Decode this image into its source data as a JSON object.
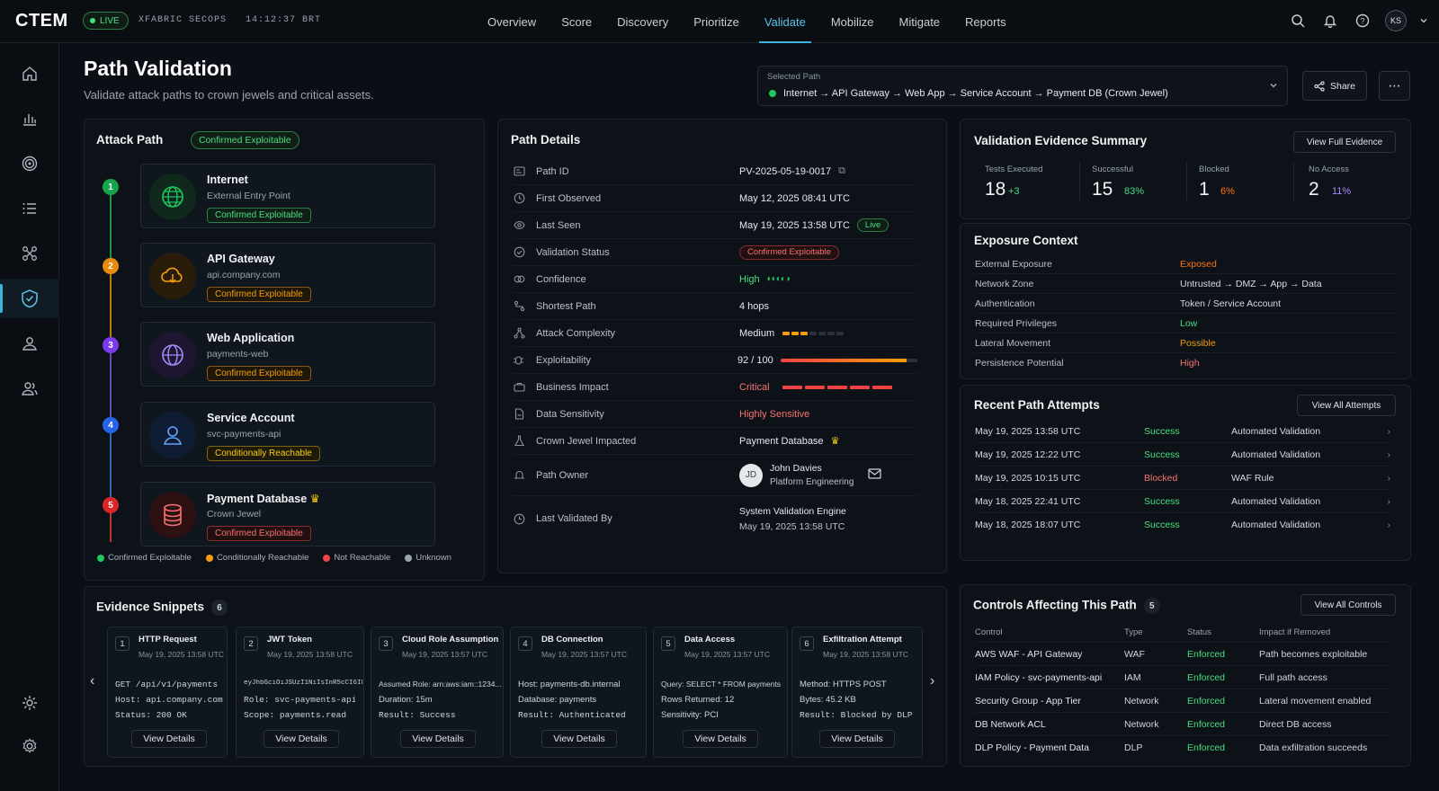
{
  "app": {
    "logo": "CTEM",
    "live": "LIVE",
    "org": "XFABRIC SECOPS",
    "clock": "14:12:37 BRT",
    "avatar": "KS"
  },
  "nav": [
    "Overview",
    "Score",
    "Discovery",
    "Prioritize",
    "Validate",
    "Mobilize",
    "Mitigate",
    "Reports"
  ],
  "page": {
    "title": "Path Validation",
    "subtitle": "Validate attack paths to crown jewels and critical assets.",
    "selected_label": "Selected Path",
    "selected_value": "Internet → API Gateway → Web App → Service Account → Payment DB (Crown Jewel)",
    "share": "Share"
  },
  "attack_path": {
    "title": "Attack Path",
    "status": "Confirmed Exploitable",
    "hops": [
      {
        "num": "1",
        "name": "Internet",
        "sub": "External Entry Point",
        "badge": "Confirmed Exploitable",
        "color": "#22c55e",
        "icon": "globe-icon"
      },
      {
        "num": "2",
        "name": "API Gateway",
        "sub": "api.company.com",
        "badge": "Confirmed Exploitable",
        "color": "#f59e0b",
        "icon": "cloud-icon"
      },
      {
        "num": "3",
        "name": "Web Application",
        "sub": "payments-web",
        "badge": "Confirmed Exploitable",
        "color": "#8b5cf6",
        "icon": "web-icon"
      },
      {
        "num": "4",
        "name": "Service Account",
        "sub": "svc-payments-api",
        "badge": "Conditionally Reachable",
        "color": "#3b82f6",
        "icon": "user-icon"
      },
      {
        "num": "5",
        "name": "Payment Database",
        "sub": "Crown Jewel",
        "badge": "Confirmed Exploitable",
        "color": "#ef4444",
        "icon": "database-icon"
      }
    ],
    "legend": [
      "Confirmed Exploitable",
      "Conditionally Reachable",
      "Not Reachable",
      "Unknown"
    ]
  },
  "details": {
    "title": "Path Details",
    "path_id_k": "Path ID",
    "path_id": "PV-2025-05-19-0017",
    "first_k": "First Observed",
    "first": "May 12, 2025 08:41 UTC",
    "last_k": "Last Seen",
    "last": "May 19, 2025 13:58 UTC",
    "live": "Live",
    "vstatus_k": "Validation Status",
    "vstatus": "Confirmed Exploitable",
    "conf_k": "Confidence",
    "conf": "High",
    "short_k": "Shortest Path",
    "short": "4 hops",
    "complex_k": "Attack Complexity",
    "complex": "Medium",
    "exploit_k": "Exploitability",
    "exploit": "92 / 100",
    "exploit_score": 0.92,
    "impact_k": "Business Impact",
    "impact": "Critical",
    "sens_k": "Data Sensitivity",
    "sens": "Highly Sensitive",
    "crown_k": "Crown Jewel Impacted",
    "crown": "Payment Database",
    "owner_k": "Path Owner",
    "owner_name": "John Davies",
    "owner_team": "Platform Engineering",
    "owner_init": "JD",
    "lvb_k": "Last Validated By",
    "lvb": "System Validation Engine",
    "lvb_date": "May 19, 2025 13:58 UTC"
  },
  "evidence_summary": {
    "title": "Validation Evidence Summary",
    "btn": "View Full Evidence",
    "stats": [
      {
        "label": "Tests Executed",
        "value": "18",
        "delta": "+3",
        "color": "#4ade80"
      },
      {
        "label": "Successful",
        "value": "15",
        "delta": "83%",
        "color": "#4ade80"
      },
      {
        "label": "Blocked",
        "value": "1",
        "delta": "6%",
        "color": "#f97316"
      },
      {
        "label": "No Access",
        "value": "2",
        "delta": "11%",
        "color": "#a78bfa"
      }
    ]
  },
  "exposure": {
    "title": "Exposure Context",
    "rows": [
      {
        "k": "External Exposure",
        "v": "Exposed",
        "c": "#f97316"
      },
      {
        "k": "Network Zone",
        "v": "Untrusted → DMZ → App → Data",
        "c": "#d6dbe1"
      },
      {
        "k": "Authentication",
        "v": "Token / Service Account",
        "c": "#d6dbe1"
      },
      {
        "k": "Required Privileges",
        "v": "Low",
        "c": "#4ade80"
      },
      {
        "k": "Lateral Movement",
        "v": "Possible",
        "c": "#f59e0b"
      },
      {
        "k": "Persistence Potential",
        "v": "High",
        "c": "#f87171"
      }
    ]
  },
  "attempts": {
    "title": "Recent Path Attempts",
    "btn": "View All Attempts",
    "rows": [
      {
        "date": "May 19, 2025 13:58 UTC",
        "status": "Success",
        "type": "Automated Validation",
        "c": "#4ade80"
      },
      {
        "date": "May 19, 2025 12:22 UTC",
        "status": "Success",
        "type": "Automated Validation",
        "c": "#4ade80"
      },
      {
        "date": "May 19, 2025 10:15 UTC",
        "status": "Blocked",
        "type": "WAF Rule",
        "c": "#f87171"
      },
      {
        "date": "May 18, 2025 22:41 UTC",
        "status": "Success",
        "type": "Automated Validation",
        "c": "#4ade80"
      },
      {
        "date": "May 18, 2025 18:07 UTC",
        "status": "Success",
        "type": "Automated Validation",
        "c": "#4ade80"
      }
    ]
  },
  "controls": {
    "title": "Controls Affecting This Path",
    "count": "5",
    "btn": "View All Controls",
    "headers": [
      "Control",
      "Type",
      "Status",
      "Impact if Removed"
    ],
    "rows": [
      {
        "control": "AWS WAF - API Gateway",
        "type": "WAF",
        "status": "Enforced",
        "impact": "Path becomes exploitable"
      },
      {
        "control": "IAM Policy - svc-payments-api",
        "type": "IAM",
        "status": "Enforced",
        "impact": "Full path access"
      },
      {
        "control": "Security Group - App Tier",
        "type": "Network",
        "status": "Enforced",
        "impact": "Lateral movement enabled"
      },
      {
        "control": "DB Network ACL",
        "type": "Network",
        "status": "Enforced",
        "impact": "Direct DB access"
      },
      {
        "control": "DLP Policy - Payment Data",
        "type": "DLP",
        "status": "Enforced",
        "impact": "Data exfiltration succeeds"
      }
    ]
  },
  "snippets": {
    "title": "Evidence Snippets",
    "count": "6",
    "btn": "View Details",
    "items": [
      {
        "num": "1",
        "title": "HTTP Request",
        "date": "May 19, 2025 13:58 UTC",
        "l1": "GET /api/v1/payments",
        "l2": "Host: api.company.com",
        "l3": "Status: 200 OK"
      },
      {
        "num": "2",
        "title": "JWT Token",
        "date": "May 19, 2025 13:58 UTC",
        "l1": "eyJhbGciOiJSUzI1NiIsInR5cCI6Ik...",
        "l2": "Role: svc-payments-api",
        "l3": "Scope: payments.read"
      },
      {
        "num": "3",
        "title": "Cloud Role Assumption",
        "date": "May 19, 2025 13:57 UTC",
        "l1": "Assumed Role: arn:aws:iam::1234...",
        "l2": "Duration: 15m",
        "l3": "Result: Success"
      },
      {
        "num": "4",
        "title": "DB Connection",
        "date": "May 19, 2025 13:57 UTC",
        "l1": "Host: payments-db.internal",
        "l2": "Database: payments",
        "l3": "Result: Authenticated"
      },
      {
        "num": "5",
        "title": "Data Access",
        "date": "May 19, 2025 13:57 UTC",
        "l1": "Query: SELECT * FROM payments",
        "l2": "Rows Returned: 12",
        "l3": "Sensitivity: PCI"
      },
      {
        "num": "6",
        "title": "Exfiltration Attempt",
        "date": "May 19, 2025 13:58 UTC",
        "l1": "Method: HTTPS POST",
        "l2": "Bytes: 45.2 KB",
        "l3": "Result: Blocked by DLP"
      }
    ]
  }
}
